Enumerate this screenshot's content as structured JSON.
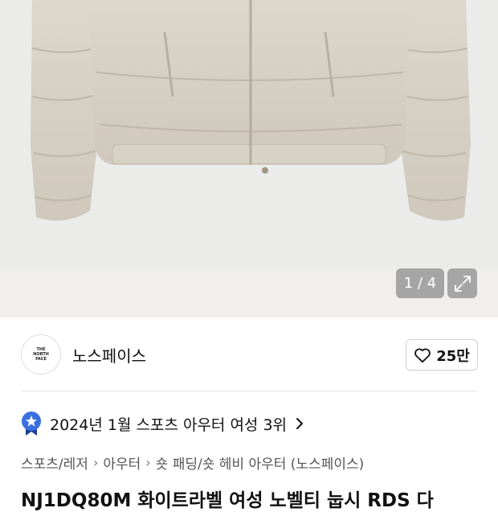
{
  "gallery": {
    "counter": "1 / 4",
    "expand_icon": "expand-icon"
  },
  "brand": {
    "logo_lines": [
      "THE",
      "NORTH",
      "FACE"
    ],
    "name": "노스페이스",
    "like_icon": "heart-icon",
    "like_count": "25만"
  },
  "ranking": {
    "badge_icon": "star-badge-icon",
    "badge_color": "#3b6fe0",
    "text": "2024년 1월 스포츠 아우터 여성 3위",
    "chevron_icon": "chevron-right-icon"
  },
  "breadcrumb": {
    "items": [
      "스포츠/레저",
      "아우터",
      "숏 패딩/숏 헤비 아우터 (노스페이스)"
    ]
  },
  "product": {
    "title": "NJ1DQ80M 화이트라벨 여성 노벨티 눕시 RDS 다"
  }
}
